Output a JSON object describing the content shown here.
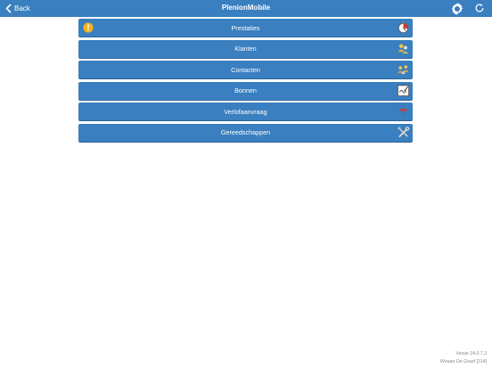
{
  "header": {
    "back_label": "Back",
    "title": "PlenionMobile",
    "actions": [
      {
        "icon": "gear-icon"
      },
      {
        "icon": "refresh-icon"
      }
    ]
  },
  "menu": {
    "items": [
      {
        "label": "Prestaties",
        "icon": "clock-icon",
        "warning": true
      },
      {
        "label": "Klanten",
        "icon": "people-icon"
      },
      {
        "label": "Contacten",
        "icon": "contacts-icon"
      },
      {
        "label": "Bonnen",
        "icon": "signature-icon"
      },
      {
        "label": "Verlofaanvraag",
        "icon": "umbrella-icon"
      },
      {
        "label": "Gereedschappen",
        "icon": "tools-icon"
      }
    ]
  },
  "footer": {
    "version": "Versie 24.0.7.3",
    "user": "Wouter De Graef [214]"
  },
  "colors": {
    "accent": "#3a7fbf",
    "warning": "#f2b21e"
  }
}
